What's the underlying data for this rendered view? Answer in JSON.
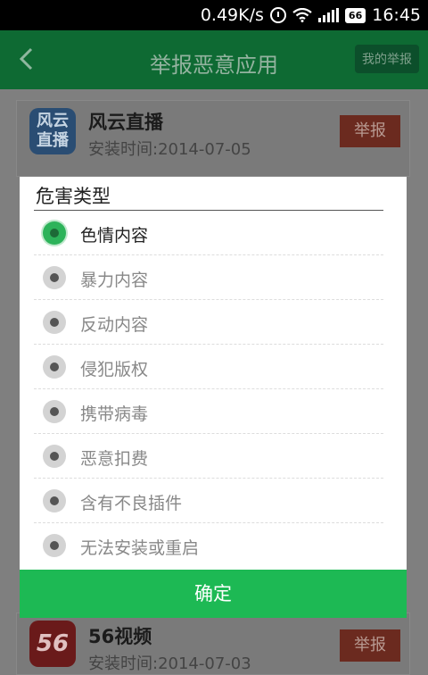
{
  "status_bar": {
    "speed": "0.49K/s",
    "battery": "66",
    "time": "16:45"
  },
  "header": {
    "back_icon": "chevron-left-icon",
    "title": "举报恶意应用",
    "my_report": "我的举报"
  },
  "apps": [
    {
      "name": "风云直播",
      "install_time": "安装时间:2014-07-05",
      "report": "举报",
      "icon_text": "风云直播"
    },
    {
      "name": "56视频",
      "install_time": "安装时间:2014-07-03",
      "report": "举报",
      "icon_text": "56"
    }
  ],
  "dialog": {
    "title": "危害类型",
    "options": [
      {
        "label": "色情内容",
        "selected": true
      },
      {
        "label": "暴力内容",
        "selected": false
      },
      {
        "label": "反动内容",
        "selected": false
      },
      {
        "label": "侵犯版权",
        "selected": false
      },
      {
        "label": "携带病毒",
        "selected": false
      },
      {
        "label": "恶意扣费",
        "selected": false
      },
      {
        "label": "含有不良插件",
        "selected": false
      },
      {
        "label": "无法安装或重启",
        "selected": false
      }
    ],
    "confirm": "确定"
  },
  "colors": {
    "accent_green": "#1db954",
    "header_green": "#0e6a33",
    "report_red": "#c0392b"
  }
}
